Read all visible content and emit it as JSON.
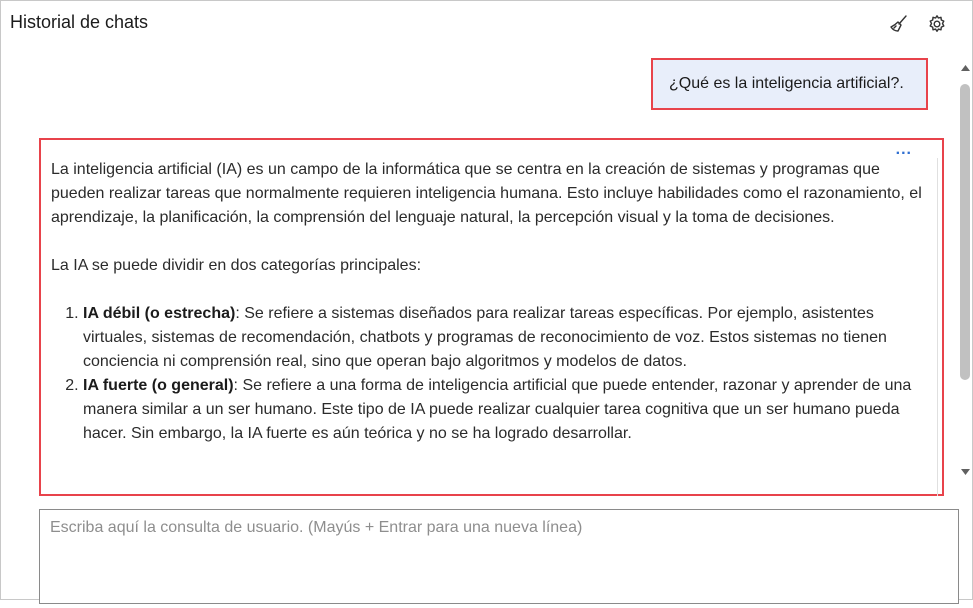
{
  "header": {
    "title": "Historial de chats",
    "icons": [
      "broom-icon",
      "gear-icon"
    ]
  },
  "messages": {
    "user": {
      "text": "¿Qué es la inteligencia artificial?."
    },
    "assistant": {
      "more_label": "...",
      "paragraph1": "La inteligencia artificial (IA) es un campo de la informática que se centra en la creación de sistemas y programas que pueden realizar tareas que normalmente requieren inteligencia humana. Esto incluye habilidades como el razonamiento, el aprendizaje, la planificación, la comprensión del lenguaje natural, la percepción visual y la toma de decisiones.",
      "paragraph2": "La IA se puede dividir en dos categorías principales:",
      "items": [
        {
          "term": "IA débil (o estrecha)",
          "text": ": Se refiere a sistemas diseñados para realizar tareas específicas. Por ejemplo, asistentes virtuales, sistemas de recomendación, chatbots y programas de reconocimiento de voz. Estos sistemas no tienen conciencia ni comprensión real, sino que operan bajo algoritmos y modelos de datos."
        },
        {
          "term": "IA fuerte (o general)",
          "text": ": Se refiere a una forma de inteligencia artificial que puede entender, razonar y aprender de una manera similar a un ser humano. Este tipo de IA puede realizar cualquier tarea cognitiva que un ser humano pueda hacer. Sin embargo, la IA fuerte es aún teórica y no se ha logrado desarrollar."
        }
      ]
    }
  },
  "input": {
    "placeholder": "Escriba aquí la consulta de usuario. (Mayús + Entrar para una nueva línea)",
    "value": ""
  },
  "colors": {
    "highlight_border": "#e8434b",
    "user_bubble": "#e8eefa",
    "accent": "#2f6fd1"
  }
}
